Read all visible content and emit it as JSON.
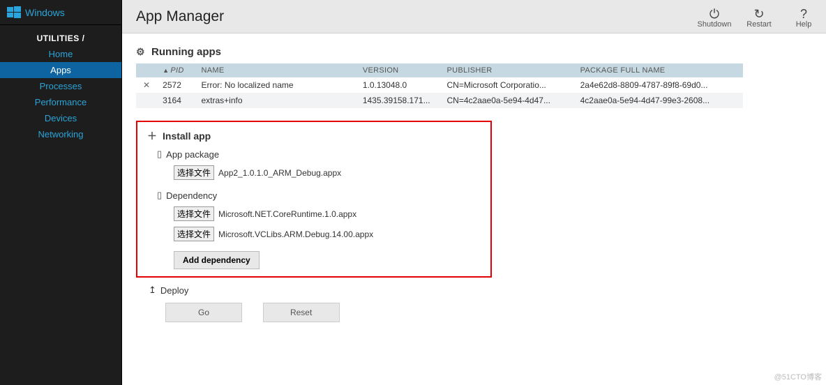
{
  "brand": {
    "name": "Windows"
  },
  "sidebar": {
    "section": "UTILITIES /",
    "items": [
      {
        "label": "Home"
      },
      {
        "label": "Apps",
        "active": true
      },
      {
        "label": "Processes"
      },
      {
        "label": "Performance"
      },
      {
        "label": "Devices"
      },
      {
        "label": "Networking"
      }
    ]
  },
  "header": {
    "title": "App Manager",
    "actions": {
      "shutdown": "Shutdown",
      "restart": "Restart",
      "help": "Help"
    }
  },
  "running": {
    "title": "Running apps",
    "columns": {
      "pid": "PID",
      "name": "NAME",
      "version": "VERSION",
      "publisher": "PUBLISHER",
      "pkg": "PACKAGE FULL NAME"
    },
    "rows": [
      {
        "close": "✕",
        "pid": "2572",
        "name": "Error: No localized name",
        "version": "1.0.13048.0",
        "publisher": "CN=Microsoft Corporatio...",
        "pkg": "2a4e62d8-8809-4787-89f8-69d0..."
      },
      {
        "close": "",
        "pid": "3164",
        "name": "extras+info",
        "version": "1435.39158.171...",
        "publisher": "CN=4c2aae0a-5e94-4d47...",
        "pkg": "4c2aae0a-5e94-4d47-99e3-2608..."
      }
    ]
  },
  "install": {
    "title": "Install app",
    "app_package_label": "App package",
    "dependency_label": "Dependency",
    "choose_file": "选择文件",
    "app_file": "App2_1.0.1.0_ARM_Debug.appx",
    "dep_files": [
      "Microsoft.NET.CoreRuntime.1.0.appx",
      "Microsoft.VCLibs.ARM.Debug.14.00.appx"
    ],
    "add_dependency": "Add dependency"
  },
  "deploy": {
    "title": "Deploy",
    "go": "Go",
    "reset": "Reset"
  },
  "watermark": "@51CTO博客"
}
